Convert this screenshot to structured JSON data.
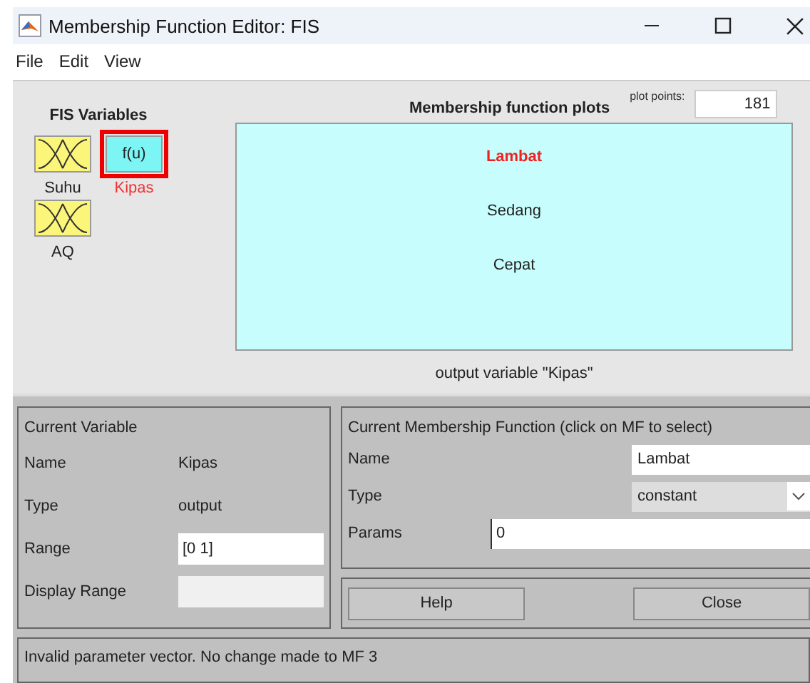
{
  "window": {
    "title": "Membership Function Editor: FIS"
  },
  "menu": [
    "File",
    "Edit",
    "View"
  ],
  "fis_variables": {
    "title": "FIS Variables",
    "items": [
      {
        "name": "Suhu",
        "kind": "input",
        "selected": false
      },
      {
        "name": "Kipas",
        "kind": "output",
        "icon_text": "f(u)",
        "selected": true
      },
      {
        "name": "AQ",
        "kind": "input",
        "selected": false
      }
    ]
  },
  "plot": {
    "title": "Membership function plots",
    "plot_points_label": "plot points:",
    "plot_points": "181",
    "mfs": [
      {
        "name": "Lambat",
        "selected": true
      },
      {
        "name": "Sedang",
        "selected": false
      },
      {
        "name": "Cepat",
        "selected": false
      }
    ],
    "caption": "output variable \"Kipas\""
  },
  "current_variable": {
    "title": "Current Variable",
    "name_label": "Name",
    "name": "Kipas",
    "type_label": "Type",
    "type": "output",
    "range_label": "Range",
    "range": "[0 1]",
    "display_range_label": "Display Range"
  },
  "current_mf": {
    "title": "Current Membership Function (click on MF to select)",
    "name_label": "Name",
    "name": "Lambat",
    "type_label": "Type",
    "type": "constant",
    "params_label": "Params",
    "params": "0"
  },
  "buttons": [
    "Help",
    "Close"
  ],
  "status": "Invalid parameter vector. No change made to MF 3"
}
